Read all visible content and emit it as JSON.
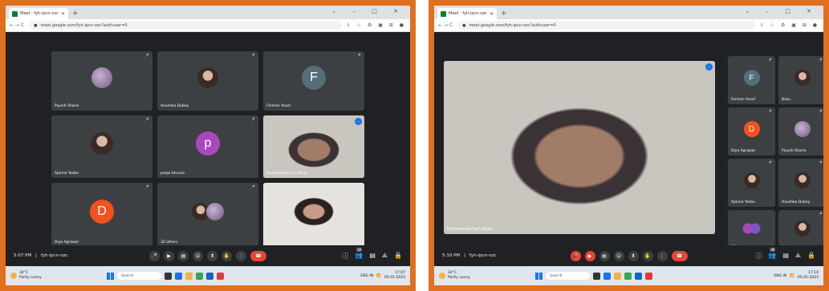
{
  "browser": {
    "tab_title": "Meet - fyh-ipcn-ozc",
    "tab_close": "✕",
    "new_tab": "+",
    "window_controls": "⌄ – □ ✕",
    "nav_icons": "← → C",
    "url": "meet.google.com/fyh-ipcn-ozc?authuser=0",
    "toolbar_icons": "⇩ ☆ ⚙ ▣ ⊞ ●"
  },
  "left": {
    "participants": [
      {
        "name": "Piyush Sharin",
        "avatar_type": "photo-lilac"
      },
      {
        "name": "Anushka Dubey",
        "avatar_type": "photo"
      },
      {
        "name": "Farman Yusuf",
        "avatar_type": "initial",
        "initial": "F",
        "color": "#546e7a"
      },
      {
        "name": "Ajanna Yadav",
        "avatar_type": "photo"
      },
      {
        "name": "pooja bhusan",
        "avatar_type": "initial",
        "initial": "p",
        "color": "#ab47bc"
      },
      {
        "name": "Muhammad Fazl Aldoo",
        "avatar_type": "video"
      },
      {
        "name": "Diya Agrawal",
        "avatar_type": "initial",
        "initial": "D",
        "color": "#f4511e"
      },
      {
        "name": "32 others",
        "avatar_type": "group"
      },
      {
        "name": "",
        "avatar_type": "video2"
      }
    ],
    "time": "5:07 PM",
    "meeting_code": "fyh-ipcn-ozc",
    "badge_count": "32"
  },
  "right": {
    "main_speaker": "Muhammad Fazl Aldoo",
    "participants": [
      {
        "name": "Farman Yusuf",
        "avatar_type": "initial",
        "initial": "F",
        "color": "#546e7a"
      },
      {
        "name": "Basu",
        "avatar_type": "photo"
      },
      {
        "name": "Diya Agrawal",
        "avatar_type": "initial",
        "initial": "D",
        "color": "#f4511e"
      },
      {
        "name": "Piyush Sharin",
        "avatar_type": "photo-lilac"
      },
      {
        "name": "Ajanna Yadav",
        "avatar_type": "photo"
      },
      {
        "name": "Anushka Dubey",
        "avatar_type": "photo"
      },
      {
        "name": "36 others",
        "avatar_type": "group"
      },
      {
        "name": "You",
        "avatar_type": "photo"
      }
    ],
    "time": "5:10 PM",
    "meeting_code": "fyh-ipcn-ozc",
    "badge_count": "36"
  },
  "controls_icons": {
    "mic": "🎤",
    "cam": "▶",
    "captions": "▤",
    "emoji": "☺",
    "present": "⬆",
    "hand": "✋",
    "more": "⋮",
    "leave": "☎",
    "info": "ⓘ",
    "people": "👥",
    "chat": "▤",
    "activities": "⟁",
    "lock": "🔒"
  },
  "taskbar": {
    "weather_temp": "34°C",
    "weather_desc": "Partly sunny",
    "search": "Search",
    "left_clock_time": "17:07",
    "left_clock_date": "05-01-2023",
    "right_clock_time": "17:10",
    "right_clock_date": "05-01-2023",
    "lang": "ENG IN"
  },
  "colors": {
    "border": "#e0701e",
    "meet_bg": "#202124",
    "tile_bg": "#3c4043",
    "leave_red": "#ea4335"
  }
}
